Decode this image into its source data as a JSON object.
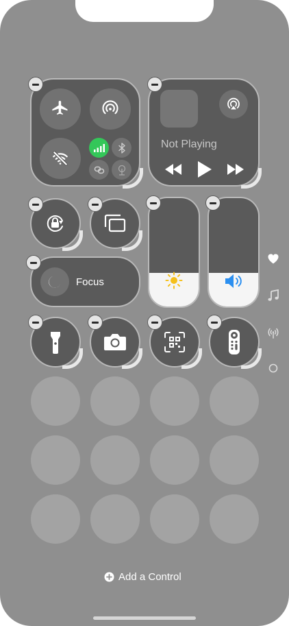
{
  "now_playing": {
    "status": "Not Playing"
  },
  "focus": {
    "label": "Focus"
  },
  "brightness": {
    "level": 0.31
  },
  "volume": {
    "level": 0.31
  },
  "footer": {
    "add_control_label": "Add a Control"
  },
  "colors": {
    "cellular_green": "#34c759",
    "volume_blue": "#2b8ff0",
    "brightness_yellow": "#f5c01c",
    "tile_bg": "#5a5a5a"
  },
  "sidebar_icons": [
    "heart-icon",
    "music-note-icon",
    "antenna-icon",
    "circle-icon"
  ]
}
